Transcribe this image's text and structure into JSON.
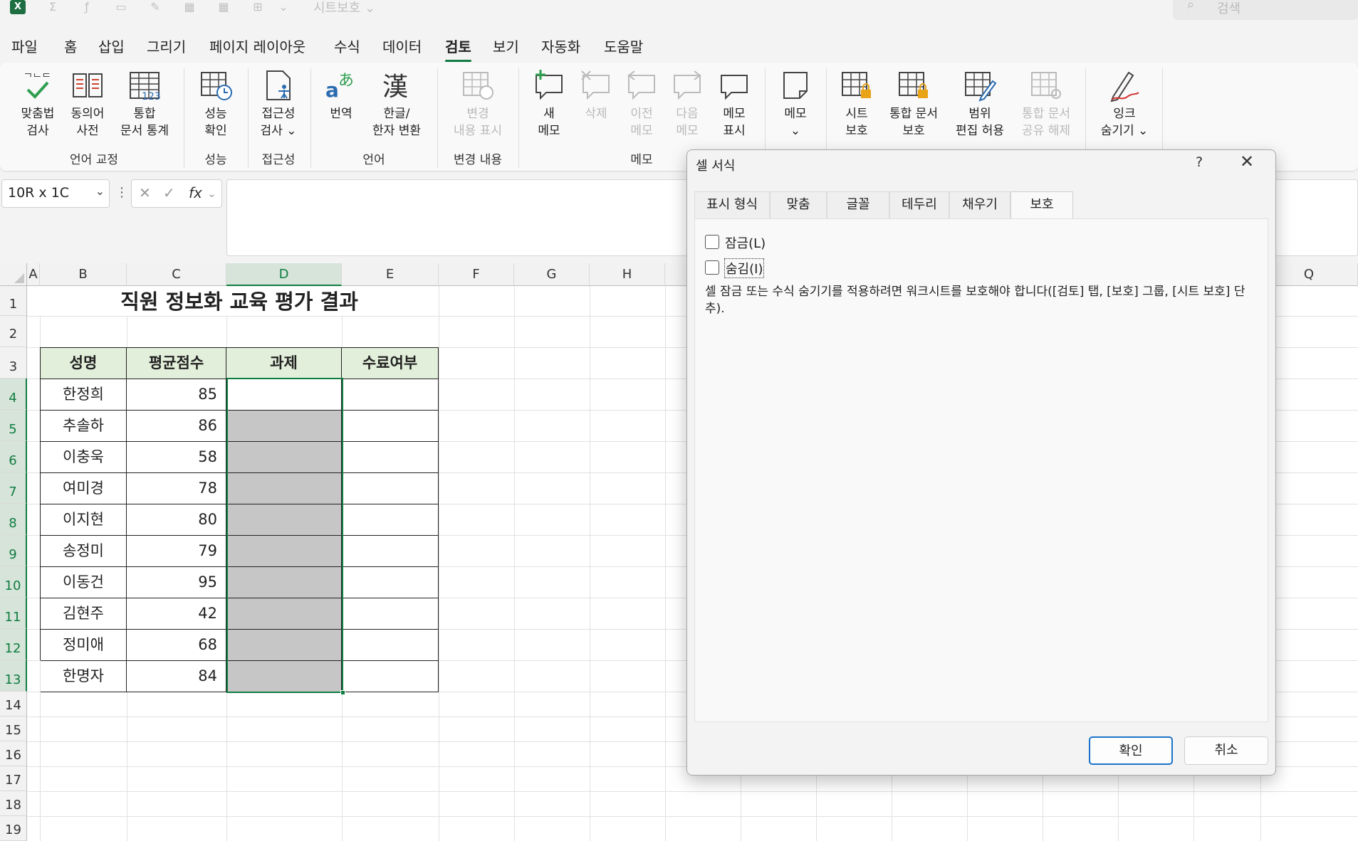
{
  "app": {
    "quick_access": {
      "doc_title": "시트보호 ⌄"
    },
    "search": {
      "placeholder": "검색"
    }
  },
  "menu_tabs": [
    "파일",
    "홈",
    "삽입",
    "그리기",
    "페이지 레이아웃",
    "수식",
    "데이터",
    "검토",
    "보기",
    "자동화",
    "도움말"
  ],
  "active_tab": "검토",
  "ribbon": {
    "buttons": {
      "spelling": "맞춤법\n검사",
      "thesaurus": "동의어\n사전",
      "workbook_stats": "통합\n문서 통계",
      "check_performance": "성능\n확인",
      "check_accessibility": "접근성\n검사 ⌄",
      "translate": "번역",
      "hangul_hanja": "한글/\n한자 변환",
      "show_changes": "변경\n내용 표시",
      "new_comment": "새\n메모",
      "delete_comment": "삭제",
      "prev_comment": "이전\n메모",
      "next_comment": "다음\n메모",
      "show_comments": "메모\n표시",
      "notes": "메모\n⌄",
      "protect_sheet": "시트\n보호",
      "protect_workbook": "통합 문서\n보호",
      "allow_edit_ranges": "범위\n편집 허용",
      "unshare_workbook": "통합 문서\n공유 해제",
      "hide_ink": "잉크\n숨기기 ⌄"
    },
    "groups": {
      "proofing": "언어 교정",
      "performance": "성능",
      "accessibility": "접근성",
      "language": "언어",
      "changes": "변경 내용",
      "comments": "메모"
    }
  },
  "formula_bar": {
    "name_box": "10R x 1C",
    "fx_label": "fx",
    "formula": ""
  },
  "columns": [
    "A",
    "B",
    "C",
    "D",
    "E",
    "F",
    "G",
    "H",
    "Q"
  ],
  "rows": [
    "1",
    "2",
    "3",
    "4",
    "5",
    "6",
    "7",
    "8",
    "9",
    "10",
    "11",
    "12",
    "13",
    "14",
    "15",
    "16",
    "17",
    "18",
    "19"
  ],
  "sheet": {
    "title": "직원 정보화 교육 평가 결과",
    "headers": [
      "성명",
      "평균점수",
      "과제",
      "수료여부"
    ],
    "records": [
      {
        "name": "한정희",
        "score": "85"
      },
      {
        "name": "추솔하",
        "score": "86"
      },
      {
        "name": "이충욱",
        "score": "58"
      },
      {
        "name": "여미경",
        "score": "78"
      },
      {
        "name": "이지현",
        "score": "80"
      },
      {
        "name": "송정미",
        "score": "79"
      },
      {
        "name": "이동건",
        "score": "95"
      },
      {
        "name": "김현주",
        "score": "42"
      },
      {
        "name": "정미애",
        "score": "68"
      },
      {
        "name": "한명자",
        "score": "84"
      }
    ]
  },
  "dialog": {
    "title": "셀 서식",
    "help": "?",
    "close": "✕",
    "tabs": [
      "표시 형식",
      "맞춤",
      "글꼴",
      "테두리",
      "채우기",
      "보호"
    ],
    "active_tab": "보호",
    "locked_label": "잠금(L)",
    "locked_checked": false,
    "hidden_label": "숨김(I)",
    "hidden_checked": false,
    "note": "셀 잠금 또는 수식 숨기기를 적용하려면 워크시트를 보호해야 합니다([검토] 탭, [보호] 그룹, [시트 보호] 단추).",
    "ok": "확인",
    "cancel": "취소"
  },
  "colors": {
    "accent": "#107c41",
    "header_fill": "#e2efda",
    "gray_fill": "#c6c6c6"
  }
}
